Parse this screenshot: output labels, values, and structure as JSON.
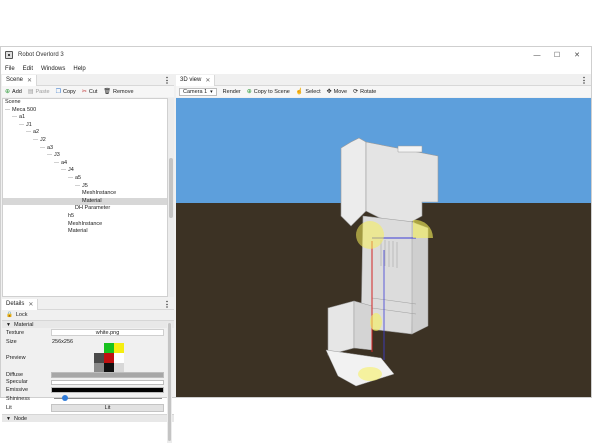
{
  "window": {
    "title": "Robot Overlord 3",
    "controls": [
      "—",
      "☐",
      "✕"
    ]
  },
  "menu": [
    "File",
    "Edit",
    "Windows",
    "Help"
  ],
  "scene_panel": {
    "tab_label": "Scene",
    "toolbar": {
      "add": "Add",
      "paste": "Paste",
      "copy": "Copy",
      "cut": "Cut",
      "remove": "Remove"
    },
    "tree": [
      {
        "label": "Scene",
        "depth": 0,
        "twisty": false
      },
      {
        "label": "Meca 500",
        "depth": 0,
        "twisty": true
      },
      {
        "label": "a1",
        "depth": 1,
        "twisty": true
      },
      {
        "label": "J1",
        "depth": 2,
        "twisty": true
      },
      {
        "label": "a2",
        "depth": 3,
        "twisty": true
      },
      {
        "label": "J2",
        "depth": 4,
        "twisty": true
      },
      {
        "label": "a3",
        "depth": 5,
        "twisty": true
      },
      {
        "label": "J3",
        "depth": 6,
        "twisty": true
      },
      {
        "label": "a4",
        "depth": 7,
        "twisty": true
      },
      {
        "label": "J4",
        "depth": 8,
        "twisty": true
      },
      {
        "label": "a5",
        "depth": 9,
        "twisty": true
      },
      {
        "label": "J5",
        "depth": 10,
        "twisty": true
      },
      {
        "label": "MeshInstance",
        "depth": 11,
        "twisty": false
      },
      {
        "label": "Material",
        "depth": 11,
        "twisty": false,
        "selected": true
      },
      {
        "label": "DH Parameter",
        "depth": 10,
        "twisty": false
      },
      {
        "label": "h5",
        "depth": 9,
        "twisty": false
      },
      {
        "label": "MeshInstance",
        "depth": 9,
        "twisty": false
      },
      {
        "label": "Material",
        "depth": 9,
        "twisty": false
      }
    ]
  },
  "details_panel": {
    "tab_label": "Details",
    "lock_label": "Lock",
    "material_section": "Material",
    "texture_label": "Texture",
    "texture_value": "white.png",
    "size_label": "Size",
    "size_value": "256x256",
    "preview_label": "Preview",
    "preview_colors": [
      "#f0f0f0",
      "#17c11e",
      "#f5ee10",
      "#4a4a4a",
      "#c01010",
      "#ffffff",
      "#8a8a8a",
      "#101010",
      "#d8d8d8"
    ],
    "diffuse_label": "Diffuse",
    "diffuse_color": "#a7a7a7",
    "specular_label": "Specular",
    "specular_color": "#ffffff",
    "emissive_label": "Emissive",
    "emissive_color": "#000000",
    "shininess_label": "Shininess",
    "shininess_level": 0.08,
    "lit_label": "Lit",
    "lit_button": "Lit",
    "node_section": "Node"
  },
  "view_panel": {
    "tab_label": "3D view",
    "camera_select": "Camera 1",
    "render": "Render",
    "copy_to_scene": "Copy to Scene",
    "select": "Select",
    "move": "Move",
    "rotate": "Rotate",
    "accent_green": "#2e9b3a"
  }
}
